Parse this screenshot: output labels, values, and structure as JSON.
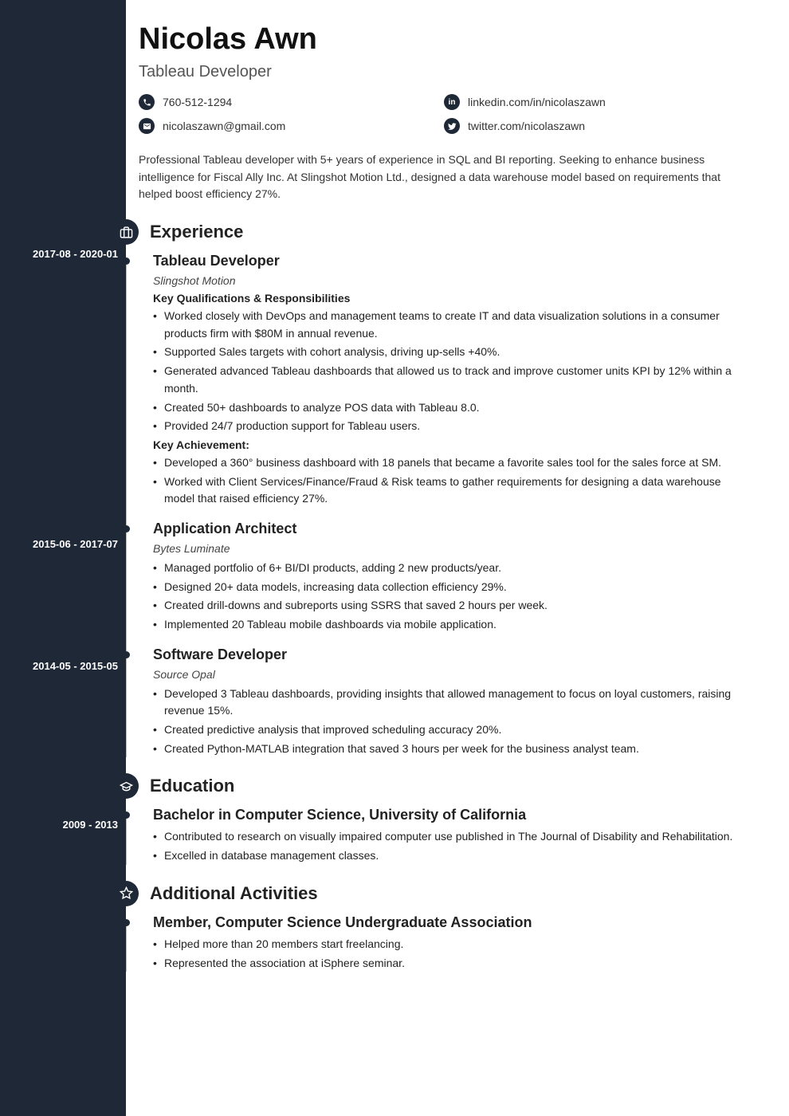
{
  "name": "Nicolas Awn",
  "title": "Tableau Developer",
  "contacts": {
    "phone": "760-512-1294",
    "linkedin": "linkedin.com/in/nicolaszawn",
    "email": "nicolaszawn@gmail.com",
    "twitter": "twitter.com/nicolaszawn"
  },
  "summary": "Professional Tableau developer with 5+ years of experience in SQL and BI reporting. Seeking to enhance business intelligence for Fiscal Ally Inc. At Slingshot Motion Ltd., designed a data warehouse model based on requirements that helped boost efficiency 27%.",
  "sections": {
    "experience": "Experience",
    "education": "Education",
    "activities": "Additional Activities"
  },
  "jobs": [
    {
      "dates": "2017-08 - 2020-01",
      "title": "Tableau Developer",
      "company": "Slingshot Motion",
      "sub1": "Key Qualifications & Responsibilities",
      "bullets1": [
        "Worked closely with DevOps and management teams to create IT and data visualization solutions in a consumer products firm with $80M in annual revenue.",
        "Supported Sales targets with cohort analysis, driving up-sells +40%.",
        "Generated advanced Tableau dashboards that allowed us to track and improve customer units KPI by 12% within a month.",
        "Created 50+ dashboards to analyze POS data with Tableau 8.0.",
        "Provided 24/7 production support for Tableau users."
      ],
      "sub2": "Key Achievement:",
      "bullets2": [
        "Developed a 360° business dashboard with 18 panels that became a favorite sales tool for the sales force at SM.",
        "Worked with Client Services/Finance/Fraud & Risk teams to gather requirements for designing a data warehouse model that raised efficiency 27%."
      ]
    },
    {
      "dates": "2015-06 - 2017-07",
      "title": "Application Architect",
      "company": "Bytes Luminate",
      "bullets1": [
        "Managed portfolio of 6+ BI/DI products, adding 2 new products/year.",
        "Designed 20+ data models, increasing data collection efficiency 29%.",
        "Created drill-downs and subreports using SSRS that saved 2 hours per week.",
        "Implemented 20 Tableau mobile dashboards via mobile application."
      ]
    },
    {
      "dates": "2014-05 - 2015-05",
      "title": "Software Developer",
      "company": "Source Opal",
      "bullets1": [
        "Developed 3 Tableau dashboards, providing insights that allowed management to focus on loyal customers, raising revenue 15%.",
        "Created predictive analysis that improved scheduling accuracy 20%.",
        "Created Python-MATLAB integration that saved 3 hours per week for the business analyst team."
      ]
    }
  ],
  "education": [
    {
      "dates": "2009 - 2013",
      "title": "Bachelor in Computer Science, University of California",
      "bullets": [
        "Contributed to research on visually impaired computer use published in The Journal of Disability and Rehabilitation.",
        "Excelled in database management classes."
      ]
    }
  ],
  "activities": [
    {
      "title": "Member, Computer Science Undergraduate Association",
      "bullets": [
        "Helped more than 20 members start freelancing.",
        "Represented the association at iSphere seminar."
      ]
    }
  ]
}
